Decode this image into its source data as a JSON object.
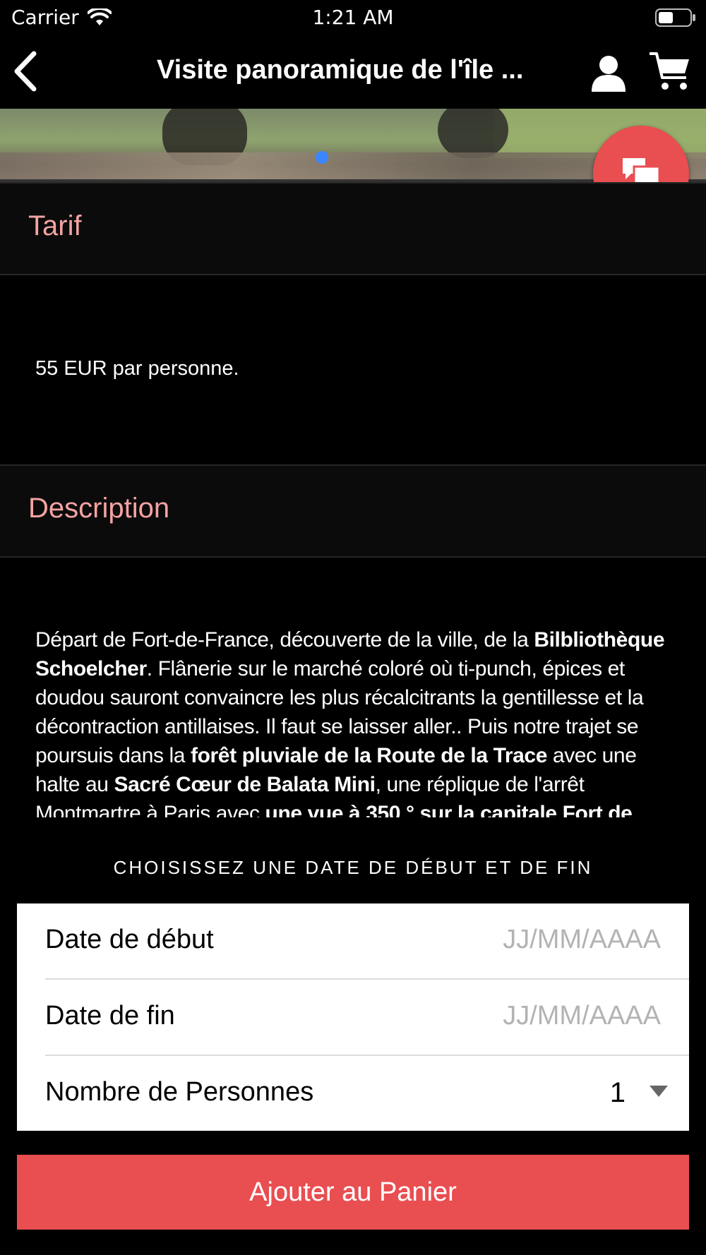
{
  "status_bar": {
    "carrier": "Carrier",
    "time": "1:21 AM"
  },
  "navbar": {
    "title": "Visite panoramique de l'île ...",
    "icons": [
      "back-icon",
      "user-icon",
      "cart-icon"
    ]
  },
  "gallery": {
    "page_indicator_color": "#3a86ff"
  },
  "chat_button": {
    "icon": "chat-bubbles-icon",
    "color": "#e94e51"
  },
  "tarif": {
    "header": "Tarif",
    "text": "55 EUR par personne."
  },
  "description": {
    "header": "Description",
    "segments": [
      {
        "t": "Départ de Fort-de-France, découverte de la ville, de la ",
        "b": false
      },
      {
        "t": "Bilbliothèque Schoelcher",
        "b": true
      },
      {
        "t": ". Flânerie sur le marché coloré où ti-punch, épices et doudou sauront convaincre les plus récalcitrants la gentillesse et la décontraction antillaises. Il faut se laisser aller.. Puis notre trajet se poursuis dans la ",
        "b": false
      },
      {
        "t": "forêt pluviale de la Route de la Trace",
        "b": true
      },
      {
        "t": " avec une halte au ",
        "b": false
      },
      {
        "t": "Sacré Cœur de Balata Mini",
        "b": true
      },
      {
        "t": ", une réplique de l'arrêt Montmartre à Paris avec ",
        "b": false
      },
      {
        "t": "une vue à 350 ° sur la capitale Fort de",
        "b": true
      }
    ]
  },
  "booking": {
    "caption": "CHOISISSEZ UNE DATE DE DÉBUT ET DE FIN",
    "start_label": "Date de début",
    "start_placeholder": "JJ/MM/AAAA",
    "end_label": "Date de fin",
    "end_placeholder": "JJ/MM/AAAA",
    "people_label": "Nombre de Personnes",
    "people_value": "1",
    "add_button": "Ajouter au Panier",
    "accent_color": "#e94e51",
    "header_text_color": "#f4a3a3"
  }
}
